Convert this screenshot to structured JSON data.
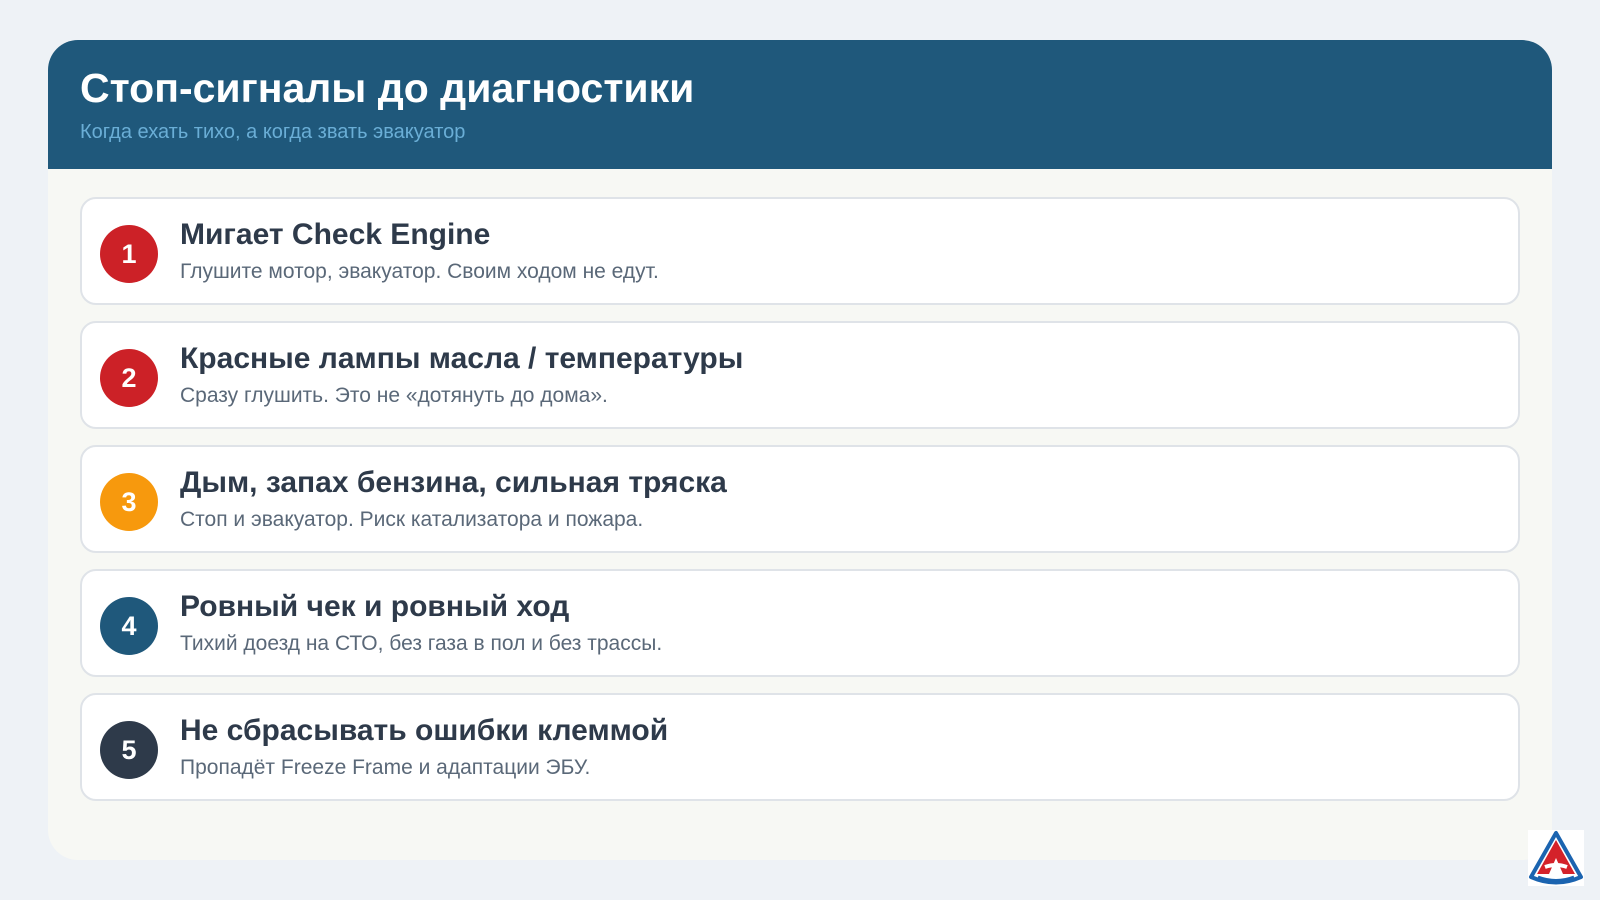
{
  "header": {
    "title": "Стоп-сигналы до диагностики",
    "subtitle": "Когда ехать тихо, а когда звать эвакуатор"
  },
  "items": [
    {
      "number": "1",
      "title": "Мигает Check Engine",
      "description": "Глушите мотор, эвакуатор. Своим ходом не едут.",
      "color": "#cc2127"
    },
    {
      "number": "2",
      "title": "Красные лампы масла / температуры",
      "description": "Сразу глушить. Это не «дотянуть до дома».",
      "color": "#cc2127"
    },
    {
      "number": "3",
      "title": "Дым, запах бензина, сильная тряска",
      "description": "Стоп и эвакуатор. Риск катализатора и пожара.",
      "color": "#f7990d"
    },
    {
      "number": "4",
      "title": "Ровный чек и ровный ход",
      "description": "Тихий доезд на СТО, без газа в пол и без трассы.",
      "color": "#1f587b"
    },
    {
      "number": "5",
      "title": "Не сбрасывать ошибки клеммой",
      "description": "Пропадёт Freeze Frame и адаптации ЭБУ.",
      "color": "#2e3a4a"
    }
  ],
  "logo": {
    "icon": "brand-logo-icon",
    "colors": {
      "blue": "#1b64b0",
      "red": "#d4222a"
    }
  }
}
